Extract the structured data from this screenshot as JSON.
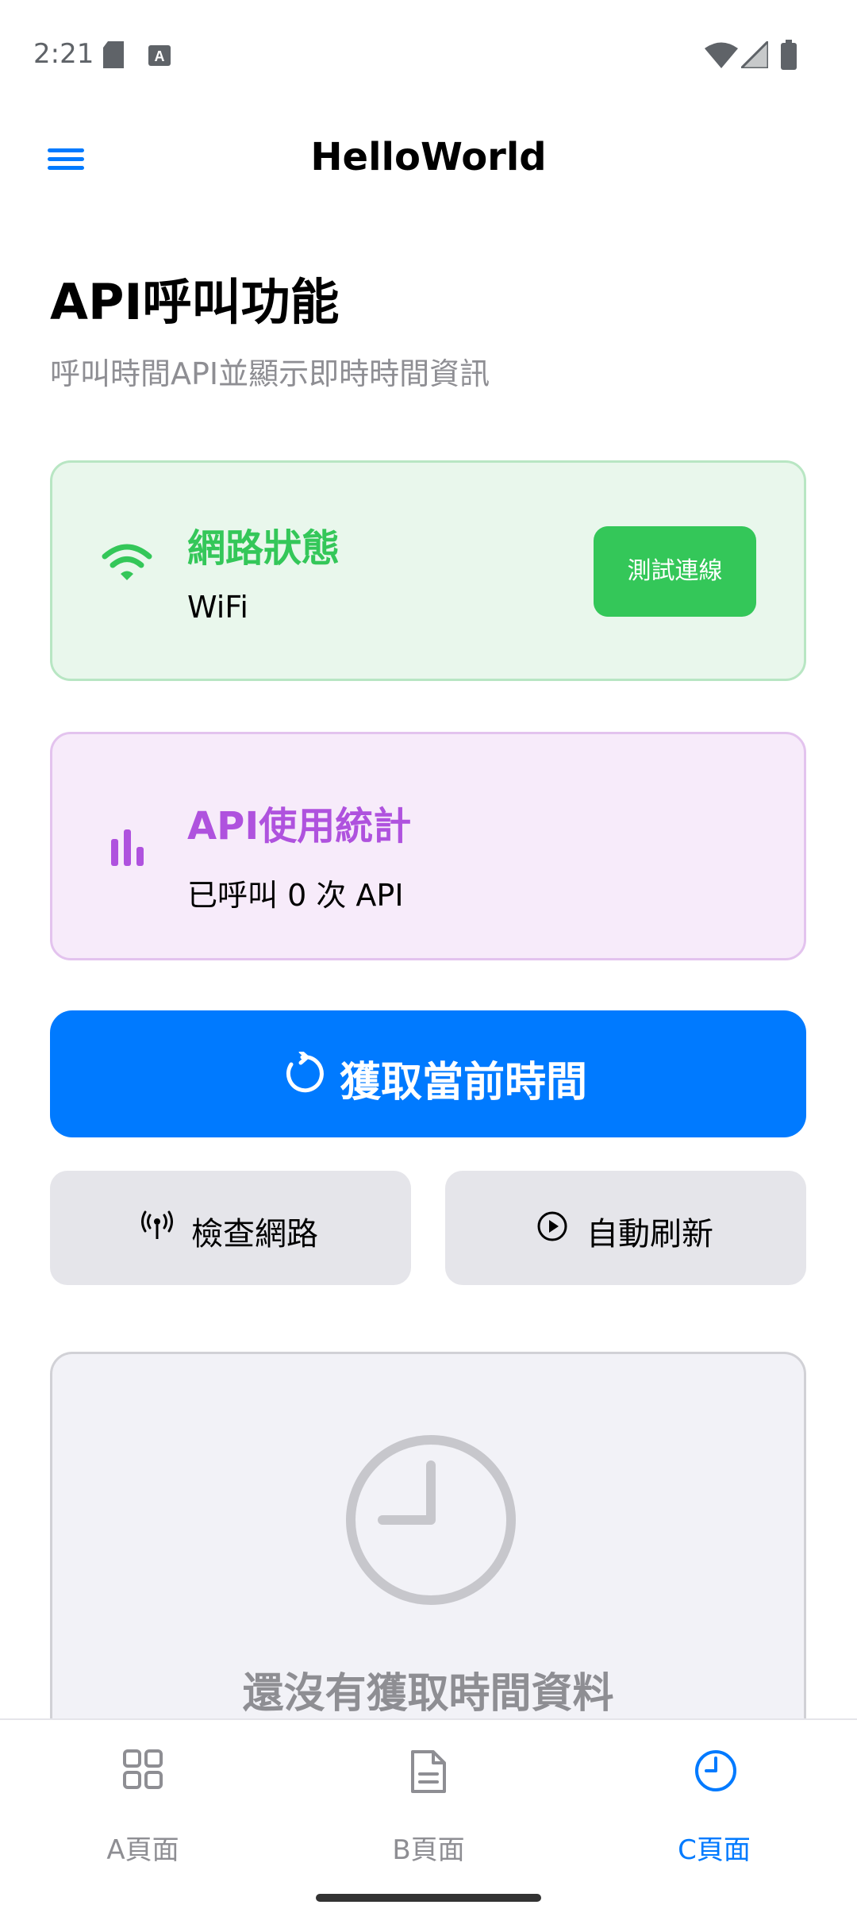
{
  "status_bar": {
    "time": "2:21"
  },
  "app_bar": {
    "title": "HelloWorld"
  },
  "page": {
    "heading": "API呼叫功能",
    "subtitle": "呼叫時間API並顯示即時時間資訊"
  },
  "network_card": {
    "title": "網路狀態",
    "value": "WiFi",
    "button_label": "測試連線",
    "accent_color": "#34c759"
  },
  "stats_card": {
    "title": "API使用統計",
    "value": "已呼叫 0 次 API",
    "accent_color": "#af52de"
  },
  "actions": {
    "primary_label": "獲取當前時間",
    "check_network_label": "檢查網路",
    "auto_refresh_label": "自動刷新"
  },
  "result": {
    "empty_text": "還沒有獲取時間資料"
  },
  "bottom_nav": {
    "tabs": [
      {
        "label": "A頁面",
        "icon": "grid-icon",
        "selected": false
      },
      {
        "label": "B頁面",
        "icon": "document-icon",
        "selected": false
      },
      {
        "label": "C頁面",
        "icon": "clock-icon",
        "selected": true
      }
    ],
    "selected_color": "#007aff",
    "unselected_color": "#8e8e93"
  }
}
